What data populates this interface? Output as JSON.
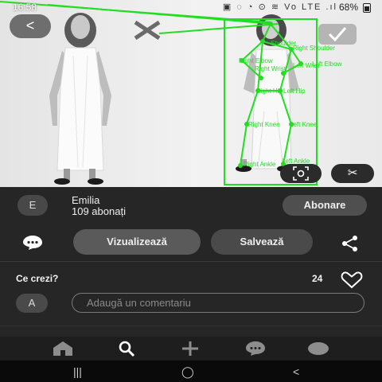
{
  "status_bar": {
    "time": "16:58",
    "battery": "68%",
    "icons_label": "▣ ◌ ◔ ⊙ ≋ Vo LTE .ıl"
  },
  "photo": {
    "back_label": "<",
    "pose_labels": [
      "Shoulder",
      "Right Shoulder",
      "Right Elbow",
      "Left Elbow",
      "Right Wrist",
      "Left Wrist",
      "Right Hip",
      "Left Hip",
      "Right Knee",
      "Left Knee",
      "Right Ankle",
      "Left Ankle"
    ]
  },
  "profile": {
    "avatar_letter": "E",
    "name": "Emilia",
    "followers": "109 abonați",
    "follow_label": "Abonare"
  },
  "actions": {
    "visualize_label": "Vizualizează",
    "save_label": "Salvează"
  },
  "comments": {
    "title": "Ce crezi?",
    "likes": "24",
    "avatar_letter": "A",
    "placeholder": "Adaugă un comentariu"
  },
  "system_nav": {
    "recents": "|||",
    "home": "◯",
    "back": "<"
  },
  "colors": {
    "pose": "#22dd22",
    "background": "#262626"
  }
}
